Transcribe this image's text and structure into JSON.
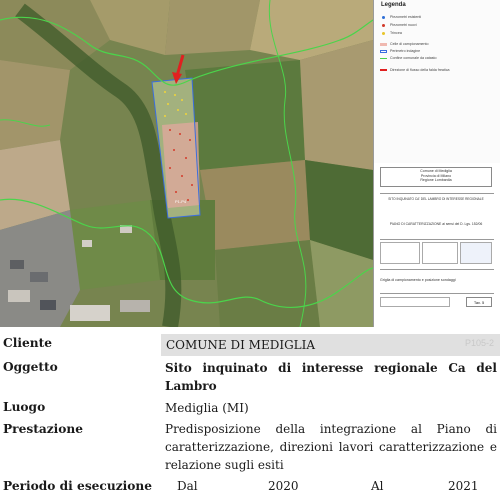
{
  "legend": {
    "title": "Legenda",
    "items": [
      {
        "label": "Piezometri esistenti",
        "color": "#2f6fd6",
        "kind": "dot"
      },
      {
        "label": "Piezometri nuovi",
        "color": "#d23a2a",
        "kind": "dot"
      },
      {
        "label": "Trincea",
        "color": "#e8c52a",
        "kind": "dot"
      },
      {
        "label": "Celle di campionamento",
        "color": "#f0b9b0",
        "kind": "fill"
      },
      {
        "label": "Perimetro indagine",
        "color": "#3a6ee0",
        "kind": "box"
      },
      {
        "label": "Confine comunale da catasto",
        "color": "#48d24a",
        "kind": "line"
      },
      {
        "label": "Direzione di flusso della falda freatica",
        "color": "#e02020",
        "kind": "arrow"
      }
    ]
  },
  "title_block": {
    "comune": "Comune di Mediglia",
    "provincia": "Provincia di Milano",
    "regione": "Regione Lombardia",
    "sito": "SITO INQUINATO CA' DEL LAMBRO DI INTERESSE REGIONALE",
    "piano": "PIANO DI CARATTERIZZAZIONE ai sensi del D. Lgs. 152/06",
    "descrizione": "Griglia di campionamento e posizione sondaggi",
    "tavola": "Tav. 5"
  },
  "map": {
    "label_point": "P1-P4"
  },
  "info": {
    "cliente_label": "Cliente",
    "cliente_value": "COMUNE DI MEDIGLIA",
    "project_id": "P105-2",
    "oggetto_label": "Oggetto",
    "oggetto_line1": "Sito inquinato di interesse regionale Ca del",
    "oggetto_line2": "Lambro",
    "luogo_label": "Luogo",
    "luogo_value": "Mediglia (MI)",
    "prestazione_label": "Prestazione",
    "prestazione_line1": "Predisposizione della integrazione al Piano di",
    "prestazione_line2": "caratterizzazione, direzioni lavori caratterizzazione e",
    "prestazione_line3": "relazione sugli esiti",
    "periodo_label": "Periodo di esecuzione",
    "dal_label": "Dal",
    "dal_value": "2020",
    "al_label": "Al",
    "al_value": "2021"
  }
}
